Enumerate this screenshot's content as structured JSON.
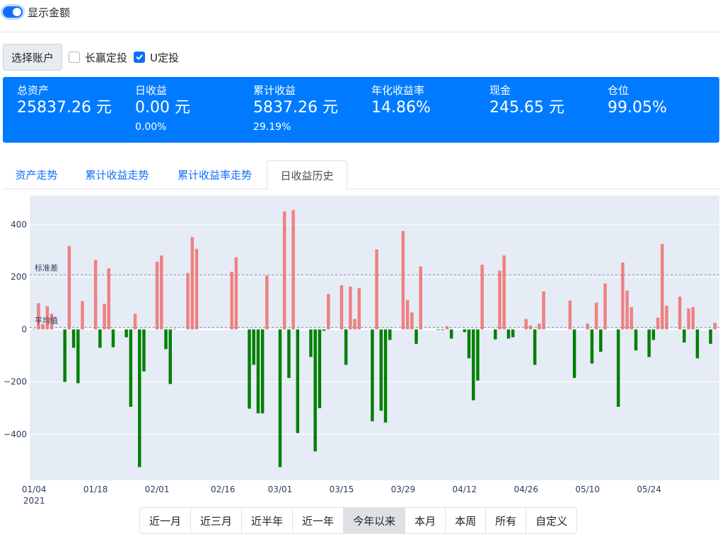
{
  "settings": {
    "show_amount_label": "显示金额"
  },
  "accounts": {
    "select_button": "选择账户",
    "options": [
      {
        "label": "长赢定投",
        "checked": false
      },
      {
        "label": "U定投",
        "checked": true
      }
    ]
  },
  "summary": {
    "items": [
      {
        "label": "总资产",
        "value": "25837.26 元",
        "sub": ""
      },
      {
        "label": "日收益",
        "value": "0.00 元",
        "sub": "0.00%"
      },
      {
        "label": "累计收益",
        "value": "5837.26 元",
        "sub": "29.19%"
      },
      {
        "label": "年化收益率",
        "value": "14.86%",
        "sub": ""
      },
      {
        "label": "现金",
        "value": "245.65 元",
        "sub": ""
      },
      {
        "label": "仓位",
        "value": "99.05%",
        "sub": ""
      }
    ]
  },
  "tabs": [
    {
      "label": "资产走势",
      "active": false
    },
    {
      "label": "累计收益走势",
      "active": false
    },
    {
      "label": "累计收益率走势",
      "active": false
    },
    {
      "label": "日收益历史",
      "active": true
    }
  ],
  "chart_data": {
    "type": "bar",
    "ylim": [
      -575,
      510
    ],
    "yticks": [
      -400,
      -200,
      0,
      200,
      400
    ],
    "ytick_labels": [
      "−400",
      "−200",
      "0",
      "200",
      "400"
    ],
    "xlim": [
      "2021-01-03",
      "2021-06-09"
    ],
    "xticks": [
      {
        "date": "2021-01-04",
        "label": "01/04",
        "sub": "2021"
      },
      {
        "date": "2021-01-18",
        "label": "01/18",
        "sub": ""
      },
      {
        "date": "2021-02-01",
        "label": "02/01",
        "sub": ""
      },
      {
        "date": "2021-02-16",
        "label": "02/16",
        "sub": ""
      },
      {
        "date": "2021-03-01",
        "label": "03/01",
        "sub": ""
      },
      {
        "date": "2021-03-15",
        "label": "03/15",
        "sub": ""
      },
      {
        "date": "2021-03-29",
        "label": "03/29",
        "sub": ""
      },
      {
        "date": "2021-04-12",
        "label": "04/12",
        "sub": ""
      },
      {
        "date": "2021-04-26",
        "label": "04/26",
        "sub": ""
      },
      {
        "date": "2021-05-10",
        "label": "05/10",
        "sub": ""
      },
      {
        "date": "2021-05-24",
        "label": "05/24",
        "sub": ""
      }
    ],
    "reference_lines": [
      {
        "label": "标准差",
        "value": 208
      },
      {
        "label": "平均值",
        "value": 8
      }
    ],
    "positive_color": "#f08080",
    "negative_color": "#008000",
    "grid": true,
    "plot_background": "#e5ecf6",
    "dates": [
      "2021-01-04",
      "2021-01-05",
      "2021-01-06",
      "2021-01-07",
      "2021-01-08",
      "2021-01-11",
      "2021-01-12",
      "2021-01-13",
      "2021-01-14",
      "2021-01-15",
      "2021-01-18",
      "2021-01-19",
      "2021-01-20",
      "2021-01-21",
      "2021-01-22",
      "2021-01-25",
      "2021-01-26",
      "2021-01-27",
      "2021-01-28",
      "2021-01-29",
      "2021-02-01",
      "2021-02-02",
      "2021-02-03",
      "2021-02-04",
      "2021-02-05",
      "2021-02-08",
      "2021-02-09",
      "2021-02-10",
      "2021-02-18",
      "2021-02-19",
      "2021-02-22",
      "2021-02-23",
      "2021-02-24",
      "2021-02-25",
      "2021-02-26",
      "2021-03-01",
      "2021-03-02",
      "2021-03-03",
      "2021-03-04",
      "2021-03-05",
      "2021-03-08",
      "2021-03-09",
      "2021-03-10",
      "2021-03-11",
      "2021-03-12",
      "2021-03-15",
      "2021-03-16",
      "2021-03-17",
      "2021-03-18",
      "2021-03-19",
      "2021-03-22",
      "2021-03-23",
      "2021-03-24",
      "2021-03-25",
      "2021-03-26",
      "2021-03-29",
      "2021-03-30",
      "2021-03-31",
      "2021-04-01",
      "2021-04-02",
      "2021-04-06",
      "2021-04-07",
      "2021-04-08",
      "2021-04-09",
      "2021-04-12",
      "2021-04-13",
      "2021-04-14",
      "2021-04-15",
      "2021-04-16",
      "2021-04-19",
      "2021-04-20",
      "2021-04-21",
      "2021-04-22",
      "2021-04-23",
      "2021-04-26",
      "2021-04-27",
      "2021-04-28",
      "2021-04-29",
      "2021-04-30",
      "2021-05-06",
      "2021-05-07",
      "2021-05-10",
      "2021-05-11",
      "2021-05-12",
      "2021-05-13",
      "2021-05-14",
      "2021-05-17",
      "2021-05-18",
      "2021-05-19",
      "2021-05-20",
      "2021-05-21",
      "2021-05-24",
      "2021-05-25",
      "2021-05-26",
      "2021-05-27",
      "2021-05-28",
      "2021-05-31",
      "2021-06-01",
      "2021-06-02",
      "2021-06-03",
      "2021-06-04",
      "2021-06-07",
      "2021-06-08"
    ],
    "values": [
      2,
      100,
      20,
      88,
      60,
      -200,
      318,
      -70,
      -205,
      108,
      265,
      -70,
      98,
      233,
      -68,
      -30,
      -295,
      60,
      -525,
      -160,
      258,
      282,
      -75,
      -208,
      2,
      215,
      352,
      307,
      220,
      275,
      -302,
      -135,
      -320,
      -320,
      205,
      -525,
      450,
      -185,
      455,
      -395,
      -105,
      -465,
      -300,
      -5,
      135,
      168,
      -135,
      163,
      40,
      157,
      -350,
      305,
      -310,
      -355,
      -40,
      375,
      112,
      65,
      -55,
      240,
      -2,
      -2,
      12,
      -35,
      -10,
      -110,
      -270,
      -195,
      247,
      -38,
      224,
      282,
      -35,
      -30,
      40,
      15,
      -135,
      22,
      145,
      110,
      -185,
      22,
      -130,
      102,
      -85,
      175,
      -295,
      255,
      148,
      85,
      -80,
      -105,
      -40,
      45,
      325,
      90,
      125,
      -50,
      80,
      85,
      -110,
      -55,
      25
    ]
  },
  "range_buttons": [
    {
      "label": "近一月",
      "active": false
    },
    {
      "label": "近三月",
      "active": false
    },
    {
      "label": "近半年",
      "active": false
    },
    {
      "label": "近一年",
      "active": false
    },
    {
      "label": "今年以来",
      "active": true
    },
    {
      "label": "本月",
      "active": false
    },
    {
      "label": "本周",
      "active": false
    },
    {
      "label": "所有",
      "active": false
    },
    {
      "label": "自定义",
      "active": false
    }
  ]
}
